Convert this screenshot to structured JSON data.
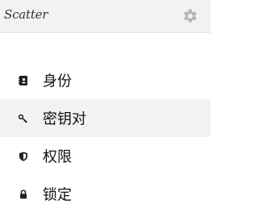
{
  "header": {
    "app_name": "Scatter",
    "settings_icon": "gear-icon"
  },
  "menu": {
    "items": [
      {
        "label": "身份",
        "icon": "address-book-icon",
        "active": false
      },
      {
        "label": "密钥对",
        "icon": "key-icon",
        "active": true
      },
      {
        "label": "权限",
        "icon": "shield-icon",
        "active": false
      },
      {
        "label": "锁定",
        "icon": "lock-icon",
        "active": false
      }
    ]
  },
  "colors": {
    "header_bg": "#f2f2f2",
    "active_bg": "#f2f2f2",
    "icon": "#222222",
    "gear": "#b5b5b5"
  }
}
